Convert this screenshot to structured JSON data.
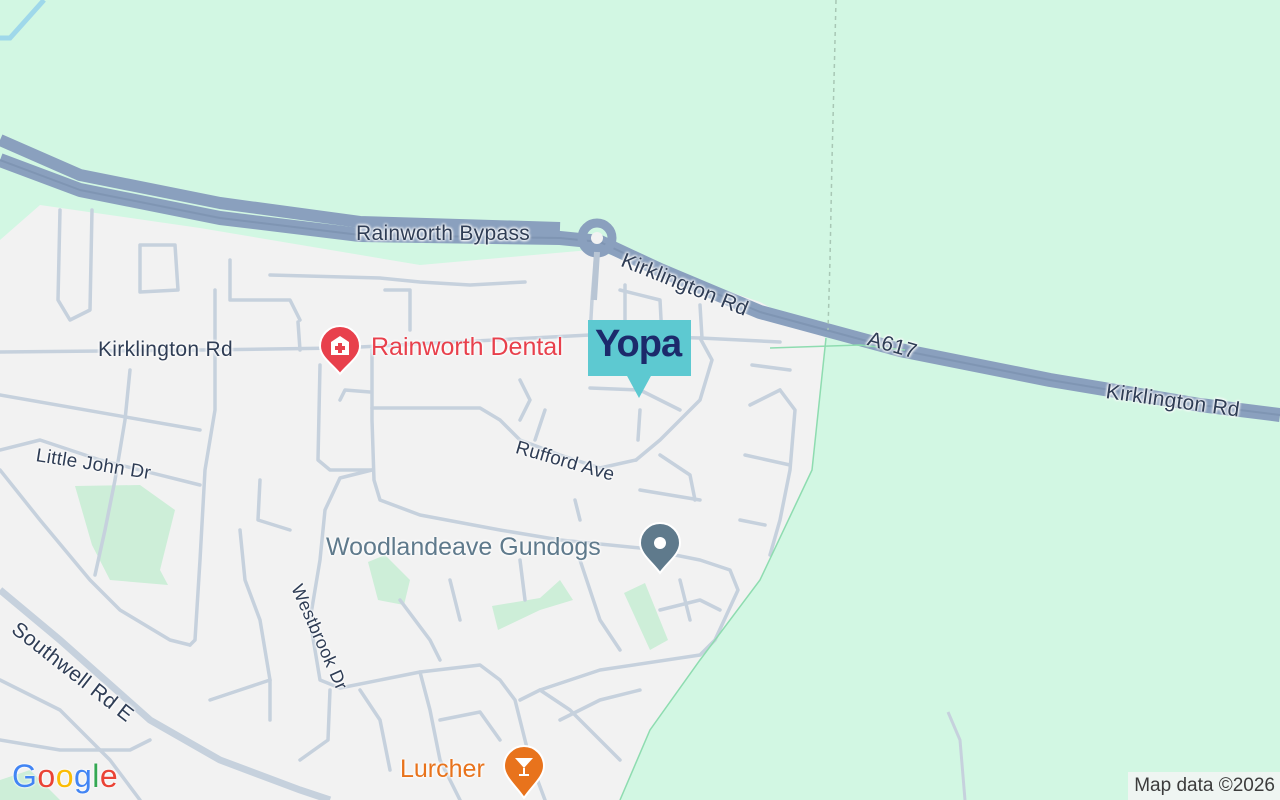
{
  "map": {
    "roads": {
      "rainworth_bypass": "Rainworth Bypass",
      "kirklington_rd_ne": "Kirklington Rd",
      "a617": "A617",
      "kirklington_rd_east": "Kirklington Rd",
      "kirklington_rd_west": "Kirklington Rd",
      "little_john_dr": "Little John Dr",
      "rufford_ave": "Rufford Ave",
      "westbrook_dr": "Westbrook Dr",
      "southwell_rd_e": "Southwell Rd E"
    },
    "pois": {
      "dental": {
        "name": "Rainworth Dental",
        "icon": "medical-cross-icon",
        "color": "#e8404c"
      },
      "gundogs": {
        "name": "Woodlandeave Gundogs",
        "icon": "location-dot-icon",
        "color": "#5f7a8c"
      },
      "lurcher": {
        "name": "Lurcher",
        "icon": "cocktail-icon",
        "color": "#e8731c"
      }
    },
    "brand_marker": {
      "text": "Yopa",
      "color": "#5dc9d1",
      "text_color": "#1c2a6b"
    },
    "colors": {
      "green_area": "#d2f7e3",
      "urban_area": "#f2f2f2",
      "major_road": "#8aa0be",
      "minor_road": "#c6d1dd",
      "water": "#9fd8ea"
    }
  },
  "branding": {
    "logo": "Google"
  },
  "attribution": "Map data ©2026"
}
